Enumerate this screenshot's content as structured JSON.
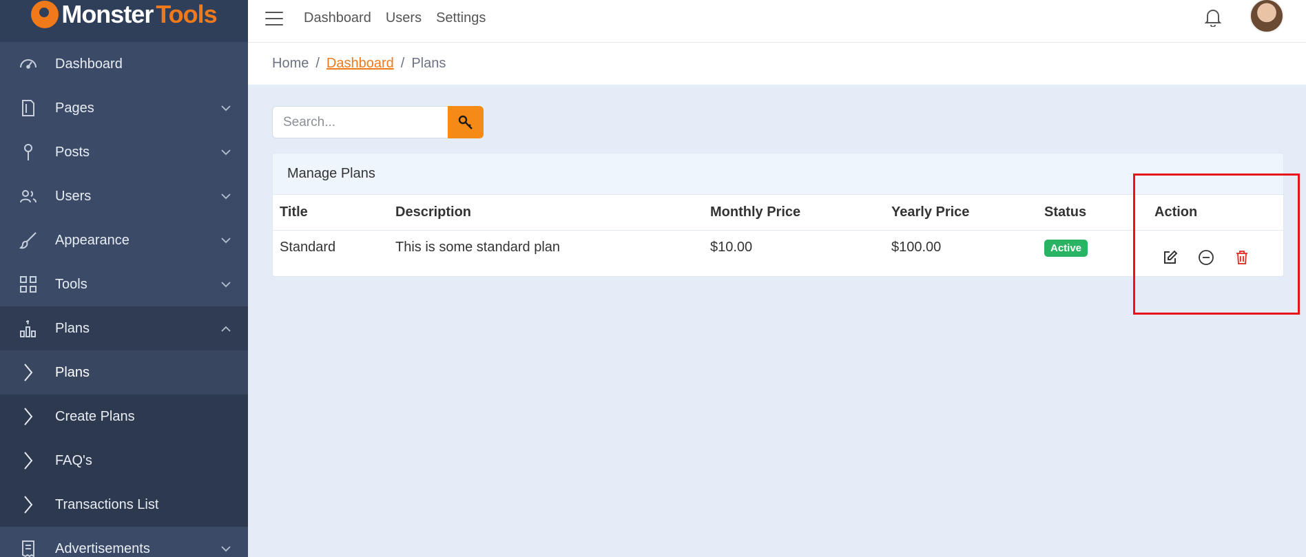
{
  "brand": {
    "part1": "Monster",
    "part2": "Tools",
    "accent": "#f07a1a"
  },
  "sidebar": {
    "items": [
      {
        "label": "Dashboard",
        "icon": "dashboard-gauge-icon"
      },
      {
        "label": "Pages",
        "icon": "pages-icon"
      },
      {
        "label": "Posts",
        "icon": "pin-icon"
      },
      {
        "label": "Users",
        "icon": "users-icon"
      },
      {
        "label": "Appearance",
        "icon": "brush-icon"
      },
      {
        "label": "Tools",
        "icon": "grid-icon"
      },
      {
        "label": "Plans",
        "icon": "plans-icon"
      },
      {
        "label": "Advertisements",
        "icon": "receipt-icon"
      }
    ],
    "plans_submenu": [
      {
        "label": "Plans"
      },
      {
        "label": "Create Plans"
      },
      {
        "label": "FAQ's"
      },
      {
        "label": "Transactions List"
      }
    ]
  },
  "topbar": {
    "links": [
      "Dashboard",
      "Users",
      "Settings"
    ]
  },
  "breadcrumb": {
    "home": "Home",
    "dashboard": "Dashboard",
    "current": "Plans",
    "sep": "/"
  },
  "search": {
    "placeholder": "Search...",
    "value": ""
  },
  "card": {
    "title": "Manage Plans",
    "columns": [
      "Title",
      "Description",
      "Monthly Price",
      "Yearly Price",
      "Status",
      "Action"
    ],
    "rows": [
      {
        "title": "Standard",
        "description": "This is some standard plan",
        "monthly": "$10.00",
        "yearly": "$100.00",
        "status": "Active"
      }
    ]
  },
  "colors": {
    "sidebar": "#3a4a67",
    "accent": "#f07a1a",
    "success": "#28b463",
    "danger": "#e53935",
    "highlight": "#e8141a"
  }
}
